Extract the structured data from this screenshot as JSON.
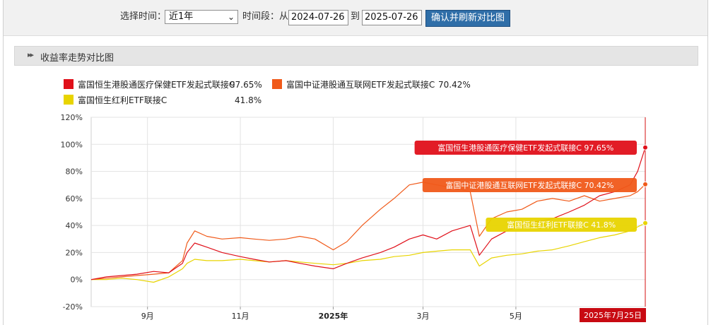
{
  "toolbar": {
    "select_time_label": "选择时间：",
    "period_value": "近1年",
    "range_label": "时间段：从",
    "start_date": "2024-07-26",
    "to_label": "到",
    "end_date": "2025-07-26",
    "refresh_button": "确认并刷新对比图"
  },
  "panel_title": "收益率走势对比图",
  "colors": {
    "series1": "#e0101a",
    "series2": "#f05a1a",
    "series3": "#e8d400",
    "button_bg": "#2f6ea8"
  },
  "legend": [
    {
      "name": "富国恒生港股通医疗保健ETF发起式联接C",
      "value": "97.65%"
    },
    {
      "name": "富国中证港股通互联网ETF发起式联接C",
      "value": "70.42%"
    },
    {
      "name": "富国恒生红利ETF联接C",
      "value": "41.8%"
    }
  ],
  "chart_data": {
    "type": "line",
    "title": "",
    "xlabel": "",
    "ylabel": "",
    "ylim": [
      -20,
      120
    ],
    "yticks": [
      "120%",
      "100%",
      "80%",
      "60%",
      "40%",
      "20%",
      "0%",
      "-20%"
    ],
    "x_range": [
      "2024-07-26",
      "2025-07-25"
    ],
    "xticks": [
      {
        "date": "2024-09-01",
        "label": "9月",
        "bold": false
      },
      {
        "date": "2024-11-01",
        "label": "11月",
        "bold": false
      },
      {
        "date": "2025-01-01",
        "label": "2025年",
        "bold": true
      },
      {
        "date": "2025-03-01",
        "label": "3月",
        "bold": false
      },
      {
        "date": "2025-05-01",
        "label": "5月",
        "bold": false
      }
    ],
    "grid": true,
    "crosshair_date": "2025-07-25",
    "crosshair_label": "2025年7月25日",
    "series": [
      {
        "name": "富国恒生港股通医疗保健ETF发起式联接C",
        "end_label": "富国恒生港股通医疗保健ETF发起式联接C 97.65%",
        "x": [
          "2024-07-26",
          "2024-08-05",
          "2024-08-15",
          "2024-08-25",
          "2024-09-05",
          "2024-09-15",
          "2024-09-24",
          "2024-09-27",
          "2024-10-02",
          "2024-10-10",
          "2024-10-20",
          "2024-11-01",
          "2024-11-10",
          "2024-11-20",
          "2024-12-01",
          "2024-12-10",
          "2024-12-20",
          "2025-01-01",
          "2025-01-10",
          "2025-01-20",
          "2025-02-01",
          "2025-02-10",
          "2025-02-20",
          "2025-03-01",
          "2025-03-10",
          "2025-03-20",
          "2025-04-01",
          "2025-04-07",
          "2025-04-15",
          "2025-04-25",
          "2025-05-05",
          "2025-05-15",
          "2025-05-25",
          "2025-06-05",
          "2025-06-15",
          "2025-06-25",
          "2025-07-05",
          "2025-07-15",
          "2025-07-20",
          "2025-07-25"
        ],
        "y": [
          0,
          2,
          3,
          4,
          6,
          5,
          12,
          20,
          27,
          24,
          20,
          17,
          15,
          13,
          14,
          12,
          10,
          8,
          12,
          16,
          20,
          24,
          30,
          33,
          30,
          36,
          40,
          18,
          30,
          36,
          40,
          43,
          45,
          50,
          55,
          62,
          65,
          70,
          80,
          97.65
        ]
      },
      {
        "name": "富国中证港股通互联网ETF发起式联接C",
        "end_label": "富国中证港股通互联网ETF发起式联接C 70.42%",
        "x": [
          "2024-07-26",
          "2024-08-05",
          "2024-08-15",
          "2024-08-25",
          "2024-09-05",
          "2024-09-15",
          "2024-09-24",
          "2024-09-27",
          "2024-10-02",
          "2024-10-10",
          "2024-10-20",
          "2024-11-01",
          "2024-11-10",
          "2024-11-20",
          "2024-12-01",
          "2024-12-10",
          "2024-12-20",
          "2025-01-01",
          "2025-01-10",
          "2025-01-20",
          "2025-02-01",
          "2025-02-10",
          "2025-02-20",
          "2025-03-01",
          "2025-03-10",
          "2025-03-20",
          "2025-04-01",
          "2025-04-07",
          "2025-04-15",
          "2025-04-25",
          "2025-05-05",
          "2025-05-15",
          "2025-05-25",
          "2025-06-05",
          "2025-06-15",
          "2025-06-25",
          "2025-07-05",
          "2025-07-15",
          "2025-07-20",
          "2025-07-25"
        ],
        "y": [
          0,
          1,
          2,
          3,
          4,
          5,
          14,
          27,
          36,
          32,
          30,
          31,
          30,
          29,
          30,
          32,
          30,
          22,
          28,
          40,
          52,
          60,
          70,
          72,
          70,
          68,
          65,
          32,
          45,
          50,
          52,
          58,
          60,
          58,
          62,
          58,
          60,
          62,
          65,
          70.42
        ]
      },
      {
        "name": "富国恒生红利ETF联接C",
        "end_label": "富国恒生红利ETF联接C 41.8%",
        "x": [
          "2024-07-26",
          "2024-08-05",
          "2024-08-15",
          "2024-08-25",
          "2024-09-05",
          "2024-09-15",
          "2024-09-24",
          "2024-09-27",
          "2024-10-02",
          "2024-10-10",
          "2024-10-20",
          "2024-11-01",
          "2024-11-10",
          "2024-11-20",
          "2024-12-01",
          "2024-12-10",
          "2024-12-20",
          "2025-01-01",
          "2025-01-10",
          "2025-01-20",
          "2025-02-01",
          "2025-02-10",
          "2025-02-20",
          "2025-03-01",
          "2025-03-10",
          "2025-03-20",
          "2025-04-01",
          "2025-04-07",
          "2025-04-15",
          "2025-04-25",
          "2025-05-05",
          "2025-05-15",
          "2025-05-25",
          "2025-06-05",
          "2025-06-15",
          "2025-06-25",
          "2025-07-05",
          "2025-07-15",
          "2025-07-20",
          "2025-07-25"
        ],
        "y": [
          0,
          0,
          1,
          0,
          -2,
          2,
          8,
          12,
          15,
          14,
          14,
          15,
          14,
          13,
          14,
          13,
          12,
          11,
          12,
          14,
          15,
          17,
          18,
          20,
          21,
          22,
          22,
          10,
          16,
          18,
          19,
          21,
          22,
          25,
          28,
          31,
          33,
          36,
          39,
          41.8
        ]
      }
    ]
  }
}
